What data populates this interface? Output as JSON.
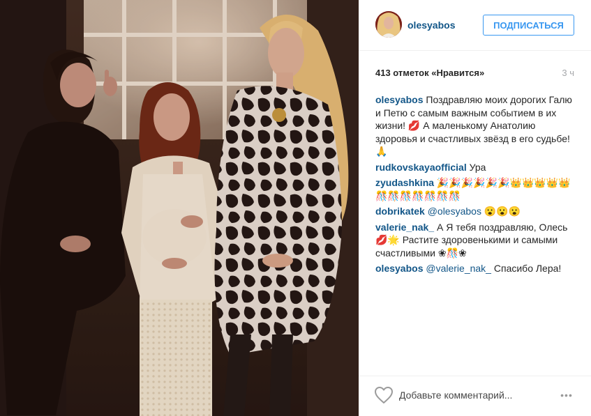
{
  "photo": {
    "alt": "Фото olesyabos"
  },
  "header": {
    "username": "olesyabos",
    "follow_label": "ПОДПИСАТЬСЯ"
  },
  "stats": {
    "likes": "413 отметок «Нравится»",
    "time": "3 ч"
  },
  "comments": [
    {
      "user": "olesyabos",
      "mention": "",
      "text": "Поздравляю моих дорогих Галю и Петю с самым важным событием в их жизни! 💋 А маленькому Анатолию здоровья и счастливых звёзд в его судьбе! 🙏"
    },
    {
      "user": "rudkovskayaofficial",
      "mention": "",
      "text": "Ура"
    },
    {
      "user": "zyudashkina",
      "mention": "",
      "text": "🎉🎉🎉🎉🎉🎉👑👑👑👑👑🎊🎊🎊🎊🎊🎊🎊"
    },
    {
      "user": "dobrikatek",
      "mention": "@olesyabos",
      "text": "😮😮😮"
    },
    {
      "user": "valerie_nak_",
      "mention": "",
      "text": "А Я тебя поздравляю, Олесь 💋🌟 Растите здоровенькими и самыми счастливыми ❀🎊❀"
    },
    {
      "user": "olesyabos",
      "mention": "@valerie_nak_",
      "text": "Спасибо Лера!"
    }
  ],
  "footer": {
    "comment_placeholder": "Добавьте комментарий...",
    "more_label": "•••"
  },
  "icons": {
    "like": "heart-outline-icon",
    "more": "ellipsis-icon"
  },
  "colors": {
    "username": "#125688",
    "follow": "#3897f0",
    "text": "#262626",
    "muted": "#a5a7aa",
    "divider": "#efefef"
  }
}
